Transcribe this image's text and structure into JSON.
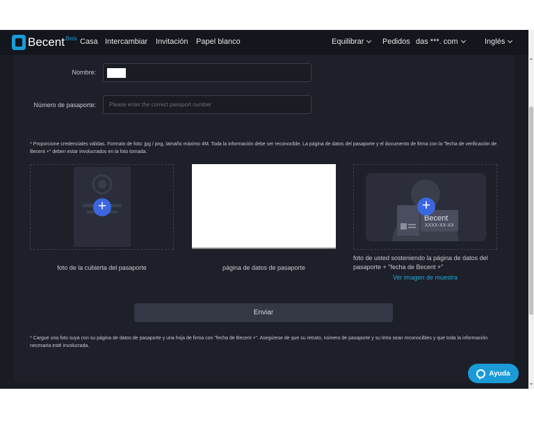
{
  "nav": {
    "brand": "Becent",
    "brand_tag": "Beta",
    "links": [
      "Casa",
      "Intercambiar",
      "Invitación",
      "Papel blanco"
    ],
    "equilibrar": "Equilibrar",
    "pedidos": "Pedidos",
    "account": "das ***. com",
    "language": "Inglés"
  },
  "form": {
    "name_label": "Nombre:",
    "passport_label": "Número de pasaporte:",
    "passport_placeholder": "Please enter the correct passport number"
  },
  "notice_top": "* Proporcione credenciales válidas. Formato de foto: jpg / png, tamaño máximo 4M. Toda la información debe ser reconocible. La página de datos del pasaporte y el documento de firma con la \"fecha de verificación de Becent +\" deben estar involucrados en la foto tomada.",
  "uploads": {
    "cover_caption": "foto de la cubierta del pasaporte",
    "data_caption": "página de datos de pasaporte",
    "selfie_caption": "foto de usted sosteniendo la página de datos del pasaporte + \"fecha de Becent +\"",
    "sample_link": "Ver imagen de muestra",
    "card_brand": "Becent",
    "card_date": "XXXX-XX-XX"
  },
  "submit_label": "Enviar",
  "notice_bottom": "* Cargue una foto suya con su página de datos de pasaporte y una hoja de firma con \"fecha de Becent +\". Asegúrese de que su retrato, número de pasaporte y su letra sean reconocibles y que toda la información necesaria esté involucrada.",
  "help_label": "Ayuda",
  "colors": {
    "accent": "#1a9bd7",
    "plus": "#3a66e0",
    "background": "#1a1c24"
  }
}
